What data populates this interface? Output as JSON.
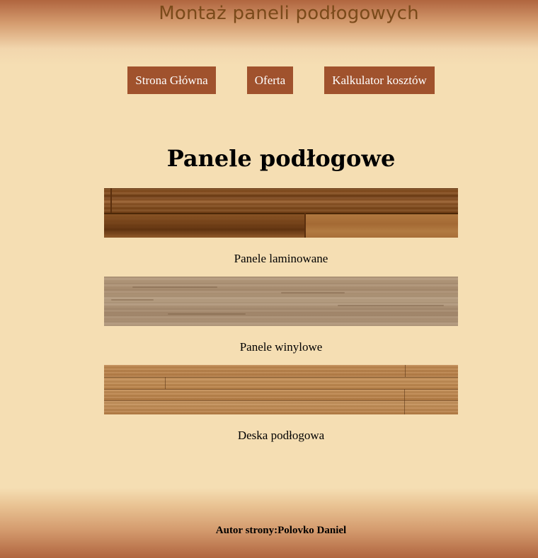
{
  "header": {
    "title": "Montaż paneli podłogowych"
  },
  "nav": {
    "items": [
      {
        "label": "Strona Główna"
      },
      {
        "label": "Oferta"
      },
      {
        "label": "Kalkulator kosztów"
      }
    ]
  },
  "main": {
    "title": "Panele podłogowe",
    "panels": [
      {
        "caption": "Panele laminowane"
      },
      {
        "caption": "Panele winylowe"
      },
      {
        "caption": "Deska podłogowa"
      }
    ]
  },
  "footer": {
    "text": "Autor strony:Polovko Daniel"
  },
  "colors": {
    "background": "#f5deb3",
    "nav_button": "#a0522d",
    "header_gradient_dark": "#b0653f",
    "title_text": "#7a4a1a"
  }
}
